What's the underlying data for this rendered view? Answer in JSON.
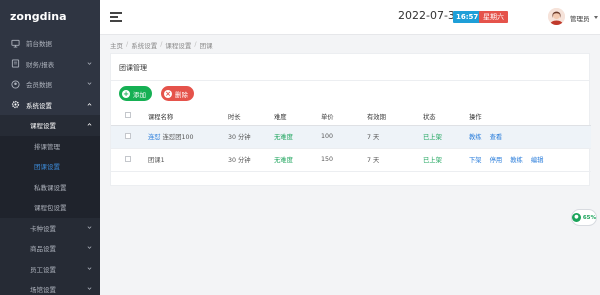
{
  "brand": "zongdina",
  "sidebar": {
    "items": [
      {
        "label": "前台数据",
        "icon": "monitor-icon",
        "has_chevron": false
      },
      {
        "label": "财务/报表",
        "icon": "ledger-icon",
        "has_chevron": true
      },
      {
        "label": "会员数据",
        "icon": "user-circle-icon",
        "has_chevron": true
      },
      {
        "label": "系统设置",
        "icon": "gear-icon",
        "has_chevron": true
      }
    ],
    "sub_items": [
      {
        "label": "课程设置",
        "level": 2,
        "open": true
      },
      {
        "label": "排课管理",
        "level": 3
      },
      {
        "label": "团课设置",
        "level": 3,
        "current": true
      },
      {
        "label": "私教课设置",
        "level": 3
      },
      {
        "label": "课程包设置",
        "level": 3
      },
      {
        "label": "卡种设置",
        "level": 2
      },
      {
        "label": "商品设置",
        "level": 2
      },
      {
        "label": "员工设置",
        "level": 2
      },
      {
        "label": "场馆设置",
        "level": 2
      }
    ]
  },
  "header": {
    "date": "2022-07-30",
    "time": "16:57",
    "weekday": "星期六",
    "user_name": "管理员"
  },
  "breadcrumb": [
    "主页",
    "系统设置",
    "课程设置",
    "团课"
  ],
  "panel": {
    "title": "团课管理",
    "add_label": "添加",
    "delete_label": "删除"
  },
  "table": {
    "headers": [
      "",
      "课程名称",
      "时长",
      "难度",
      "单价",
      "有效期",
      "状态",
      "操作"
    ],
    "rows": [
      {
        "name_link": "连怼",
        "name": "连怼团100",
        "duration": "30 分钟",
        "difficulty": "无难度",
        "price": "100",
        "validity": "7 天",
        "status": "已上架",
        "ops": [
          "教练",
          "查看"
        ],
        "highlighted": true
      },
      {
        "name_link": "",
        "name": "团课1",
        "duration": "30 分钟",
        "difficulty": "无难度",
        "price": "150",
        "validity": "7 天",
        "status": "已上架",
        "ops": [
          "下架",
          "停用",
          "教练",
          "编辑"
        ],
        "highlighted": false
      }
    ]
  },
  "float_badge": {
    "icon": "chat-icon",
    "text": "65%"
  },
  "colors": {
    "sidebar_bg": "#2f3542",
    "accent": "#2a7ddb",
    "green": "#16b054",
    "red": "#e5534b",
    "time_badge": "#1e9fd8"
  }
}
